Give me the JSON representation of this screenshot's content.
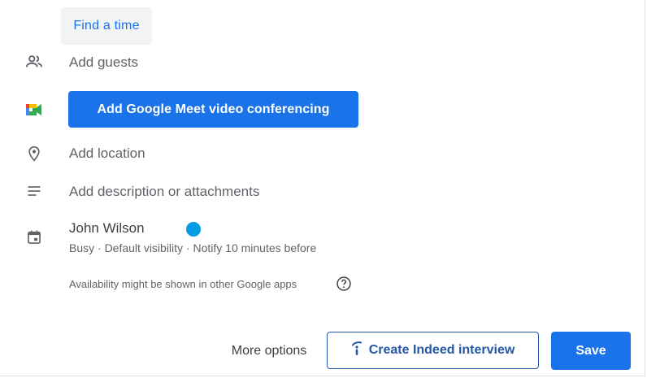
{
  "find_time": {
    "label": "Find a time"
  },
  "guests": {
    "placeholder": "Add guests",
    "icon": "people-icon"
  },
  "conferencing": {
    "button_label": "Add Google Meet video conferencing",
    "icon": "google-meet-icon"
  },
  "location": {
    "placeholder": "Add location",
    "icon": "location-pin-icon"
  },
  "description": {
    "placeholder": "Add description or attachments",
    "icon": "notes-icon"
  },
  "calendar": {
    "icon": "calendar-icon",
    "owner": "John Wilson",
    "color": "#039be5",
    "meta": "Busy · Default visibility · Notify 10 minutes before"
  },
  "availability_note": "Availability might be shown in other Google apps",
  "footer": {
    "more_options": "More options",
    "indeed_label": "Create Indeed interview",
    "save_label": "Save"
  },
  "colors": {
    "accent": "#1a73e8",
    "indeed": "#2557a7"
  }
}
